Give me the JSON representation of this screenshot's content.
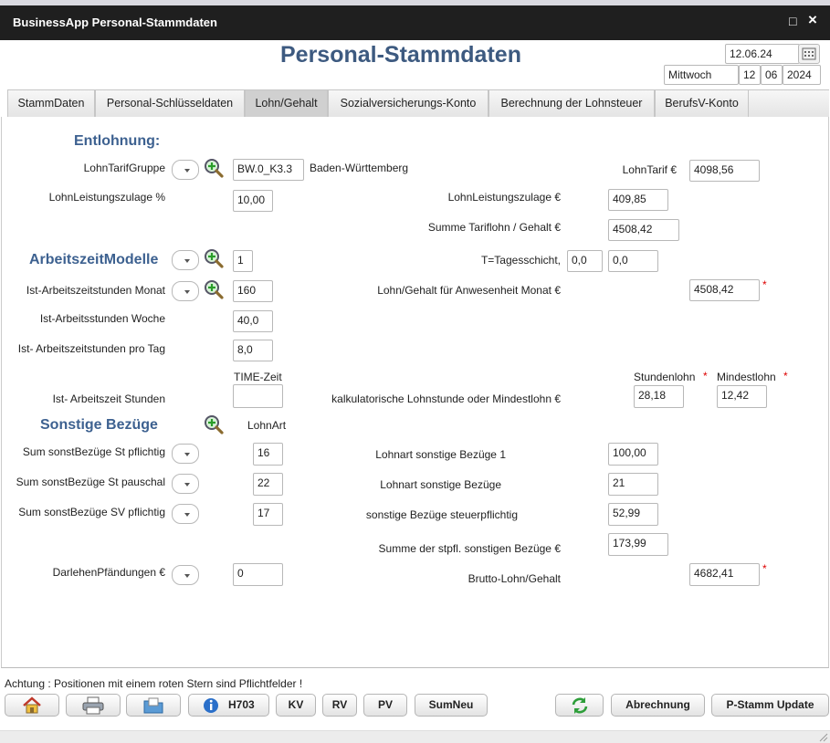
{
  "window": {
    "title": "BusinessApp Personal-Stammdaten",
    "maximize_glyph": "□",
    "close_glyph": "×"
  },
  "page": {
    "title": "Personal-Stammdaten"
  },
  "date": {
    "value": "12.06.24",
    "weekday": "Mittwoch",
    "day": "12",
    "month": "06",
    "year": "2024"
  },
  "tabs": [
    {
      "label": "StammDaten"
    },
    {
      "label": "Personal-Schlüsseldaten"
    },
    {
      "label": "Lohn/Gehalt",
      "active": true
    },
    {
      "label": "Sozialversicherungs-Konto"
    },
    {
      "label": "Berechnung der Lohnsteuer"
    },
    {
      "label": "BerufsV-Konto"
    }
  ],
  "entlohnung": {
    "heading": "Entlohnung:",
    "lohntarifgruppe_label": "LohnTarifGruppe",
    "lohntarifgruppe_value": "BW.0_K3.3",
    "region": "Baden-Württemberg",
    "lohntarif_label": "LohnTarif €",
    "lohntarif_value": "4098,56",
    "leistungszulage_pct_label": "LohnLeistungszulage %",
    "leistungszulage_pct_value": "10,00",
    "leistungszulage_eur_label": "LohnLeistungszulage €",
    "leistungszulage_eur_value": "409,85",
    "summe_tarif_label": "Summe Tariflohn / Gehalt €",
    "summe_tarif_value": "4508,42"
  },
  "arbeitszeit": {
    "heading": "ArbeitszeitModelle",
    "modell_value": "1",
    "tagesschicht_label": "T=Tagesschicht,",
    "tagesschicht_value1": "0,0",
    "tagesschicht_value2": "0,0",
    "ist_monat_label": "Ist-Arbeitszeitstunden Monat",
    "ist_monat_value": "160",
    "anwesenheit_label": "Lohn/Gehalt für Anwesenheit Monat €",
    "anwesenheit_value": "4508,42",
    "woche_label": "Ist-Arbeitsstunden Woche",
    "woche_value": "40,0",
    "tag_label": "Ist- Arbeitszeitstunden pro Tag",
    "tag_value": "8,0",
    "time_zeit_label": "TIME-Zeit",
    "ist_stunden_label": "Ist- Arbeitszeit Stunden",
    "ist_stunden_value": "",
    "kalk_label": "kalkulatorische Lohnstunde oder Mindestlohn €",
    "stundenlohn_label": "Stundenlohn",
    "stundenlohn_value": "28,18",
    "mindestlohn_label": "Mindestlohn",
    "mindestlohn_value": "12,42"
  },
  "sonstige": {
    "heading": "Sonstige Bezüge",
    "lohnart_label": "LohnArt",
    "row1_label": "Sum sonstBezüge St pflichtig",
    "row1_lohnart": "16",
    "row1_desc": "Lohnart sonstige Bezüge 1",
    "row1_value": "100,00",
    "row2_label": "Sum sonstBezüge St pauschal",
    "row2_lohnart": "22",
    "row2_desc": "Lohnart sonstige Bezüge",
    "row2_value": "21",
    "row3_label": "Sum sonstBezüge SV pflichtig",
    "row3_lohnart": "17",
    "row3_desc": "sonstige Bezüge steuerpflichtig",
    "row3_value": "52,99",
    "summe_label": "Summe der stpfl. sonstigen Bezüge €",
    "summe_value": "173,99",
    "darlehen_label": "DarlehenPfändungen €",
    "darlehen_value": "0",
    "brutto_label": "Brutto-Lohn/Gehalt",
    "brutto_value": "4682,41"
  },
  "star": "*",
  "notice": "Achtung : Positionen mit einem roten Stern sind Pflichtfelder !",
  "buttons": {
    "h703": "H703",
    "kv": "KV",
    "rv": "RV",
    "pv": "PV",
    "sumneu": "SumNeu",
    "abrechnung": "Abrechnung",
    "pstamm": "P-Stamm Update"
  },
  "colors": {
    "titlebar": "#1f1f1f",
    "heading": "#3d6190",
    "required": "#dd0000"
  }
}
